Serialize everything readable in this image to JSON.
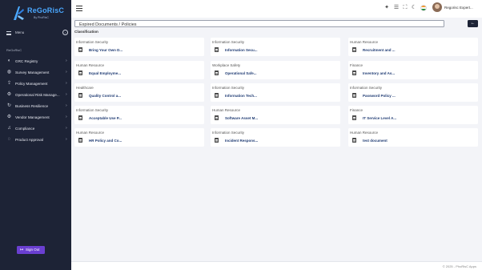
{
  "app": {
    "logo_text": "ReGoRisC",
    "logo_sub": "By PhoRisC",
    "menu_label": "Menu",
    "section_label": "ReGoRisC"
  },
  "sidebar": {
    "items": [
      {
        "label": "GRC Registry",
        "icon": "registry-icon",
        "glyph": "◐"
      },
      {
        "label": "Survey Management",
        "icon": "survey-icon",
        "glyph": "◍"
      },
      {
        "label": "Policy Management",
        "icon": "policy-icon",
        "glyph": "⇪"
      },
      {
        "label": "Operational Risk Manage...",
        "icon": "risk-icon",
        "glyph": "⚙"
      },
      {
        "label": "Business Resilience",
        "icon": "resilience-icon",
        "glyph": "↻"
      },
      {
        "label": "Vendor Management",
        "icon": "vendor-icon",
        "glyph": "⚙"
      },
      {
        "label": "Compliance",
        "icon": "compliance-icon",
        "glyph": "♫"
      },
      {
        "label": "Product Approval",
        "icon": "product-approval-icon",
        "glyph": "◌"
      }
    ],
    "signout_label": "Sign Out"
  },
  "topbar": {
    "user_name": "Regorisc Expert..."
  },
  "page": {
    "title": "Expired Documents / Policies",
    "classification_label": "Classification"
  },
  "cards": [
    {
      "category": "Information Security",
      "title": "Bring Your Own D..."
    },
    {
      "category": "Information Security",
      "title": "Information Secu..."
    },
    {
      "category": "Human Resource",
      "title": "Recruitment and ..."
    },
    {
      "category": "Human Resource",
      "title": "Equal Employme..."
    },
    {
      "category": "Workplace Safety",
      "title": "Operational Safe..."
    },
    {
      "category": "Finance",
      "title": "Inventory and As..."
    },
    {
      "category": "Healthcare",
      "title": "Quality Control a..."
    },
    {
      "category": "Information Security",
      "title": "Information Tech..."
    },
    {
      "category": "Information Security",
      "title": "Password Policy ..."
    },
    {
      "category": "Information Security",
      "title": "Acceptable Use P..."
    },
    {
      "category": "Human Resource",
      "title": "Software Asset M..."
    },
    {
      "category": "Finance",
      "title": "IT Service Level A..."
    },
    {
      "category": "Human Resource",
      "title": "HR Policy and Co..."
    },
    {
      "category": "Information Security",
      "title": "Incident Respons..."
    },
    {
      "category": "Human Resource",
      "title": "test document"
    }
  ],
  "footer": {
    "text": "© 2025 - PhoRisC Apps"
  },
  "colors": {
    "sidebar_bg": "#1d2336",
    "accent": "#6a3fd1",
    "link": "#1f3b73"
  }
}
